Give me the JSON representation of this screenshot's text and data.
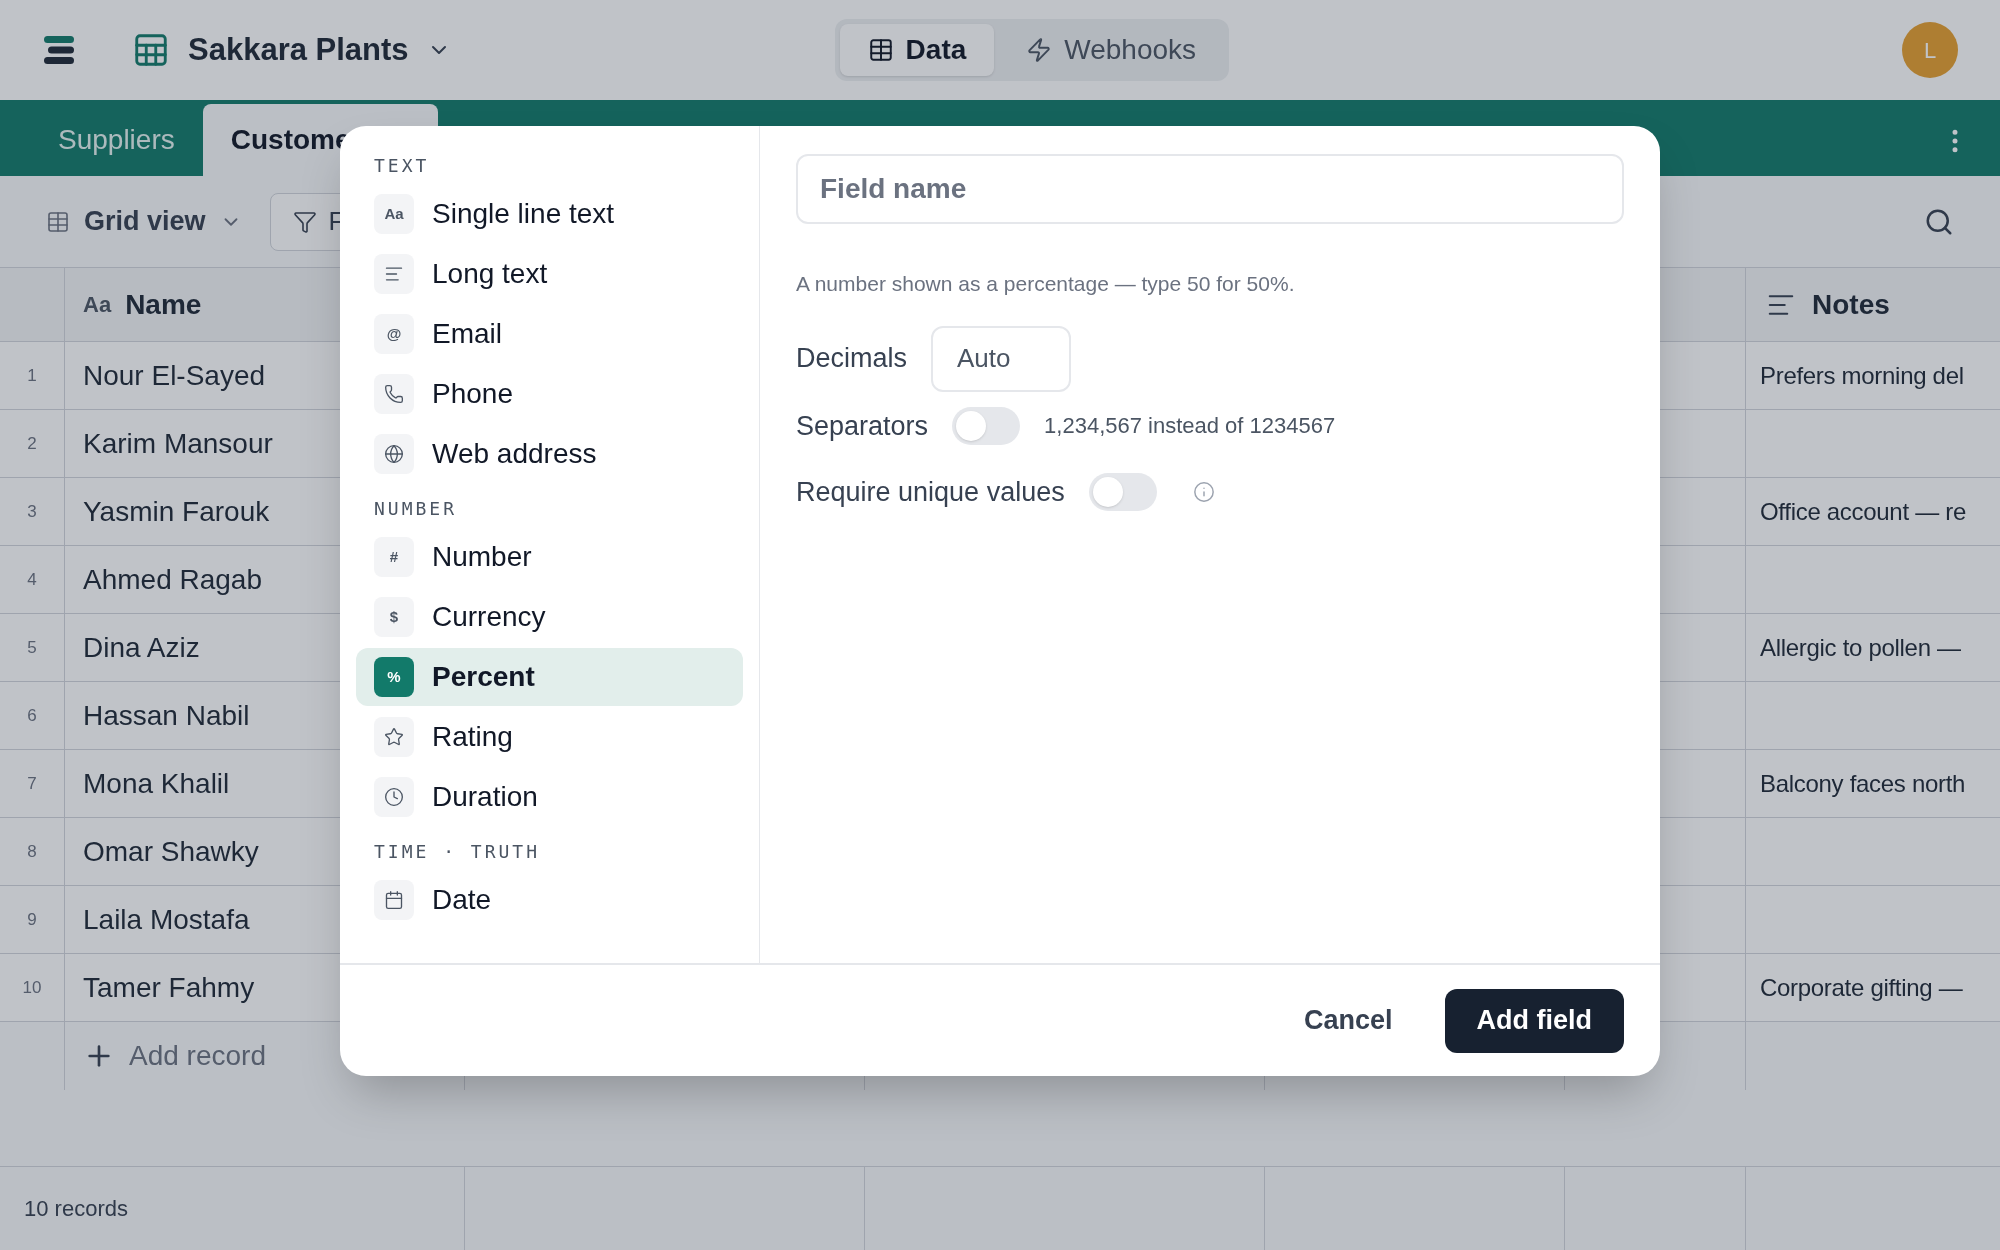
{
  "app": {
    "title": "Sakkara Plants",
    "avatar": "L"
  },
  "views": [
    {
      "label": "Data",
      "kind": "table",
      "selected": true
    },
    {
      "label": "Webhooks",
      "kind": "zap",
      "selected": false
    }
  ],
  "table_tabs": [
    {
      "label": "Suppliers",
      "selected": false
    },
    {
      "label": "Custome",
      "selected": true
    }
  ],
  "toolbar": {
    "view": "Grid view",
    "filter": "F"
  },
  "columns": [
    {
      "label": "Name",
      "glyph": "Aa"
    },
    {
      "label": "Notes",
      "kind": "lines"
    }
  ],
  "rows": [
    {
      "number": "1",
      "name": "Nour El-Sayed",
      "notes": "Prefers morning del"
    },
    {
      "number": "2",
      "name": "Karim Mansour"
    },
    {
      "number": "3",
      "name": "Yasmin Farouk",
      "notes": "Office account — re"
    },
    {
      "number": "4",
      "name": "Ahmed Ragab"
    },
    {
      "number": "5",
      "name": "Dina Aziz",
      "notes": "Allergic to pollen —"
    },
    {
      "number": "6",
      "name": "Hassan Nabil"
    },
    {
      "number": "7",
      "name": "Mona Khalil",
      "notes": "Balcony faces north"
    },
    {
      "number": "8",
      "name": "Omar Shawky"
    },
    {
      "number": "9",
      "name": "Laila Mostafa"
    },
    {
      "number": "10",
      "name": "Tamer Fahmy",
      "notes": "Corporate gifting —"
    }
  ],
  "add_record": "Add record",
  "status_bar": "10 records",
  "dialog": {
    "groups": [
      {
        "heading": "TEXT",
        "items": [
          {
            "label": "Single line text",
            "glyph": "Aa",
            "selected": false
          },
          {
            "label": "Long text",
            "kind": "lines",
            "selected": false
          },
          {
            "label": "Email",
            "glyph": "@",
            "selected": false
          },
          {
            "label": "Phone",
            "kind": "phone",
            "selected": false
          },
          {
            "label": "Web address",
            "kind": "globe",
            "selected": false
          }
        ]
      },
      {
        "heading": "NUMBER",
        "items": [
          {
            "label": "Number",
            "glyph": "#",
            "selected": false
          },
          {
            "label": "Currency",
            "glyph": "$",
            "selected": false
          },
          {
            "label": "Percent",
            "glyph": "%",
            "selected": true
          },
          {
            "label": "Rating",
            "kind": "star",
            "selected": false
          },
          {
            "label": "Duration",
            "kind": "clock",
            "selected": false
          }
        ]
      },
      {
        "heading": "TIME · TRUTH",
        "items": [
          {
            "label": "Date",
            "kind": "calendar",
            "selected": false
          }
        ]
      }
    ],
    "field_name": {
      "placeholder": "Field name"
    },
    "description": "A number shown as a percentage — type 50 for 50%.",
    "decimals": {
      "label": "Decimals",
      "value": "Auto"
    },
    "separators": {
      "label": "Separators",
      "on": false,
      "hint": "1,234,567 instead of 1234567"
    },
    "unique": {
      "label": "Require unique values",
      "on": false
    },
    "buttons": {
      "cancel": "Cancel",
      "confirm": "Add field"
    }
  }
}
